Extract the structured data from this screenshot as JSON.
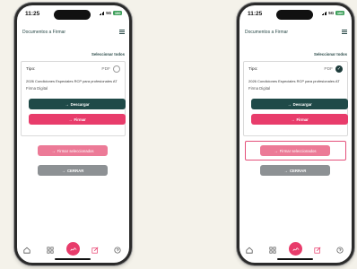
{
  "status_bar": {
    "time": "11:25",
    "network": "5G",
    "battery": "100"
  },
  "header": {
    "title": "Documentos a Firmar"
  },
  "select_all_label": "Seleccionar todos",
  "document": {
    "type_label": "Tipo:",
    "format": "PDF",
    "name": "2026 Condiciones Especiales RCP para profesionales AT",
    "signature_type": "Firma Digital"
  },
  "buttons": {
    "download": "Descargar",
    "sign": "Firmar",
    "sign_selected": "Firmar seleccionados",
    "close": "CERRAR"
  },
  "tabbar": [
    "home-icon",
    "grid-icon",
    "sign-icon",
    "edit-icon",
    "help-icon"
  ],
  "colors": {
    "primary_dark": "#1f4a48",
    "accent_pink": "#e83c6b",
    "highlight": "#e4507a",
    "disabled_gray": "#8d9194"
  }
}
